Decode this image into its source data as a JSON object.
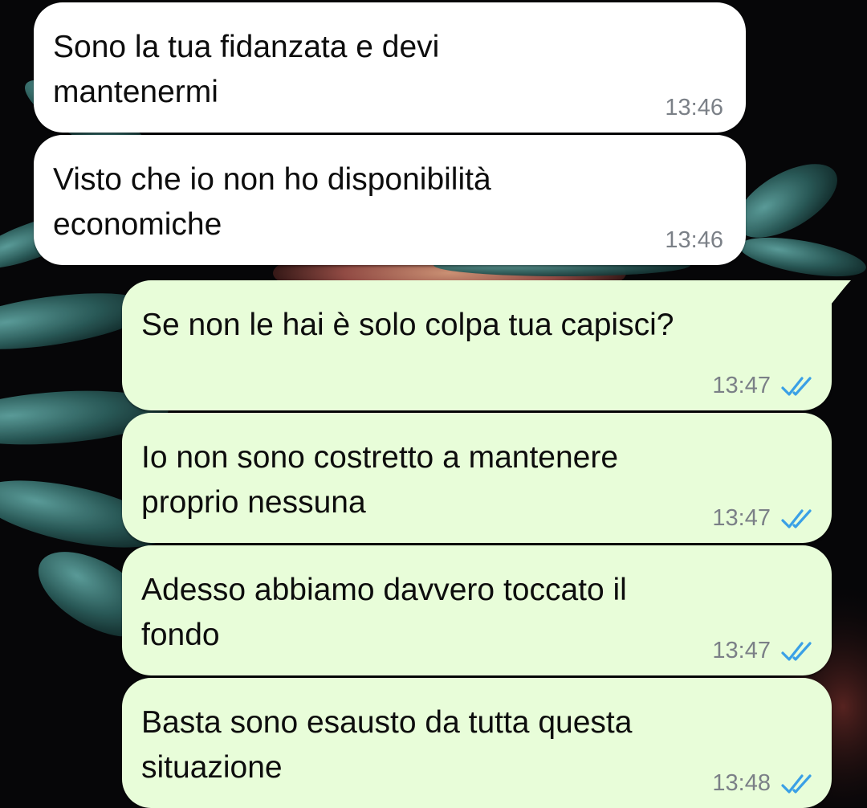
{
  "colors": {
    "incoming_bubble": "#ffffff",
    "outgoing_bubble": "#e8fdd9",
    "read_ticks": "#3aa0e6",
    "timestamp": "#7b8087",
    "text": "#0d0d0d"
  },
  "chat": {
    "messages": [
      {
        "direction": "incoming",
        "text": "Sono la tua fidanzata e devi\nmantenermi",
        "time": "13:46"
      },
      {
        "direction": "incoming",
        "text": "Visto che io non ho disponibilità\neconomiche",
        "time": "13:46"
      },
      {
        "direction": "outgoing",
        "text": "Se non le hai è solo colpa tua capisci?",
        "time": "13:47",
        "status_icon": "double-check-read-icon"
      },
      {
        "direction": "outgoing",
        "text": "Io non sono costretto a mantenere\nproprio nessuna",
        "time": "13:47",
        "status_icon": "double-check-read-icon"
      },
      {
        "direction": "outgoing",
        "text": "Adesso abbiamo davvero toccato il\nfondo",
        "time": "13:47",
        "status_icon": "double-check-read-icon"
      },
      {
        "direction": "outgoing",
        "text": "Basta sono esausto da tutta questa\nsituazione",
        "time": "13:48",
        "status_icon": "double-check-read-icon"
      }
    ]
  }
}
